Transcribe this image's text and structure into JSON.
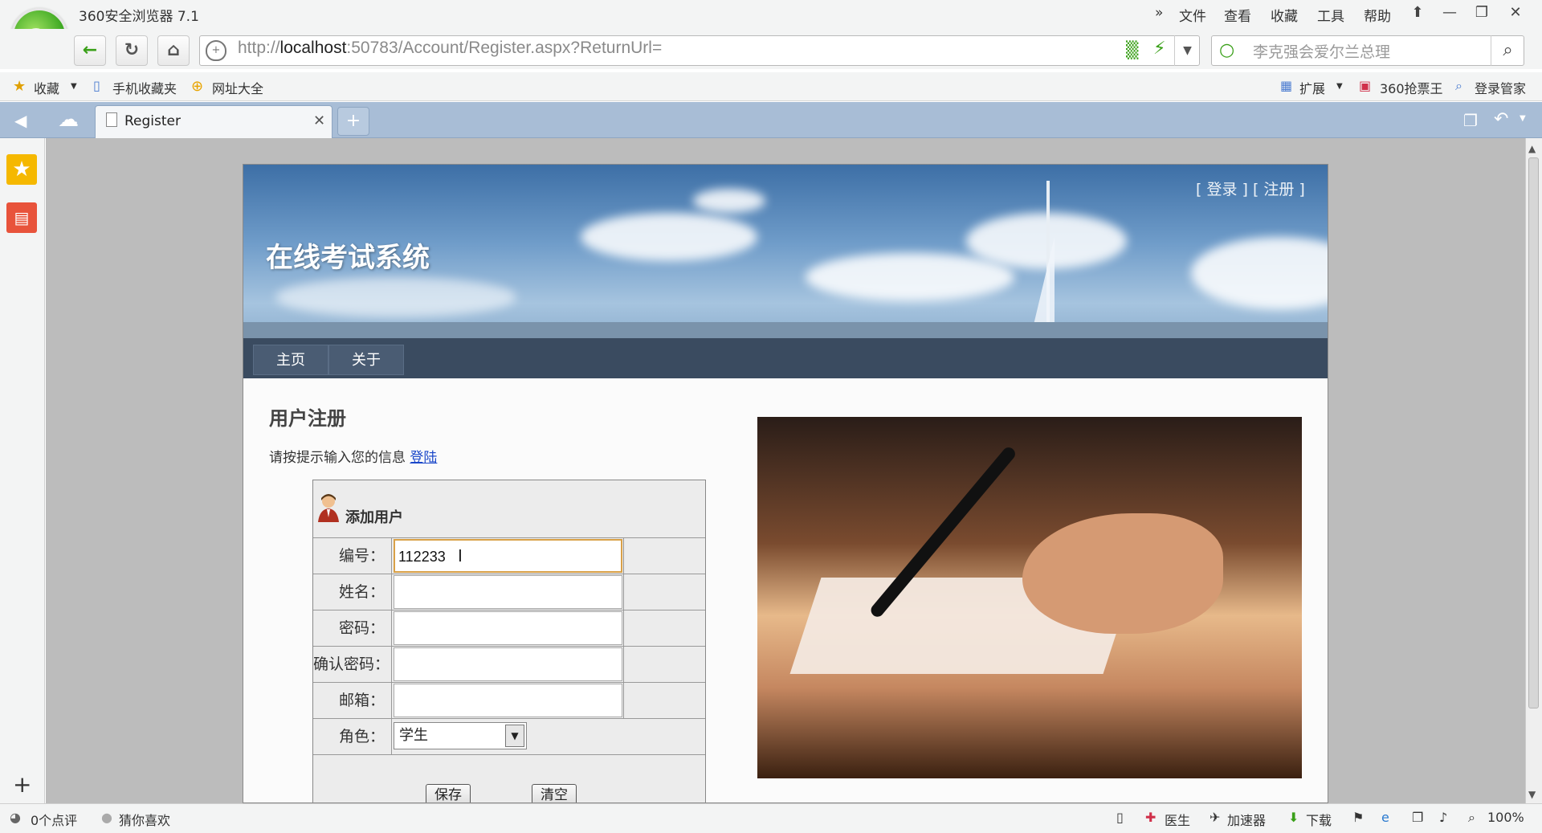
{
  "browser": {
    "title": "360安全浏览器 7.1",
    "menu": [
      "文件",
      "查看",
      "收藏",
      "工具",
      "帮助"
    ],
    "url_prefix": "http://",
    "url_host": "localhost",
    "url_rest": ":50783/Account/Register.aspx?ReturnUrl=",
    "search_placeholder": "李克强会爱尔兰总理",
    "bookmarks": {
      "favorites": "收藏",
      "mobile": "手机收藏夹",
      "sites": "网址大全",
      "extensions": "扩展",
      "tickets": "360抢票王",
      "login_manager": "登录管家"
    },
    "tab_label": "Register",
    "status": {
      "reviews": "0个点评",
      "guess": "猜你喜欢",
      "doctor": "医生",
      "accelerator": "加速器",
      "download": "下载",
      "zoom": "100%"
    }
  },
  "page": {
    "site_title": "在线考试系统",
    "login_links": "[ 登录 ] [ 注册 ]",
    "nav": [
      "主页",
      "关于"
    ],
    "heading": "用户注册",
    "hint": "请按提示输入您的信息",
    "hint_link": "登陆",
    "form": {
      "title": "添加用户",
      "fields": [
        {
          "label": "编号：",
          "value": "112233"
        },
        {
          "label": "姓名：",
          "value": ""
        },
        {
          "label": "密码：",
          "value": ""
        },
        {
          "label": "确认密码：",
          "value": ""
        },
        {
          "label": "邮箱：",
          "value": ""
        }
      ],
      "role_label": "角色：",
      "role_value": "学生",
      "save": "保存",
      "clear": "清空"
    }
  }
}
